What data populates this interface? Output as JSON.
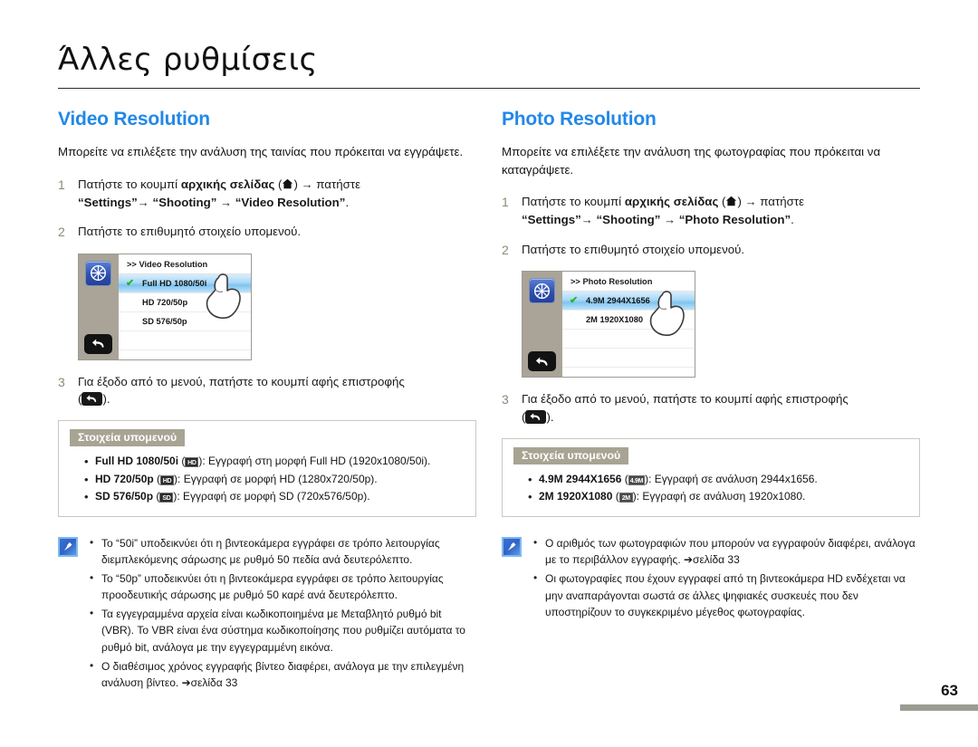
{
  "header": {
    "title": "Άλλες ρυθμίσεις"
  },
  "page_number": "63",
  "left": {
    "section_title": "Video Resolution",
    "intro": "Μπορείτε να επιλέξετε την ανάλυση της ταινίας που πρόκειται να εγγράψετε.",
    "steps": [
      {
        "num": "1",
        "lead": "Πατήστε το κουμπί ",
        "bold1": "αρχικής σελίδας",
        "paren_open": " (",
        "icon": "home-icon",
        "paren_close": ") ",
        "arrow1": "→",
        "mid": " πατήστε ",
        "q1": "“Settings”",
        "arrow2": "→",
        "q2": "“Shooting”",
        "arrow3": "→",
        "q3": "“Video Resolution”",
        "end": "."
      },
      {
        "num": "2",
        "text": "Πατήστε το επιθυμητό στοιχείο υπομενού."
      },
      {
        "num": "3",
        "text": "Για έξοδο από το μενού, πατήστε το κουμπί αφής επιστροφής",
        "tail_open": "(",
        "tail_icon": "return-icon",
        "tail_close": ")."
      }
    ],
    "lcd": {
      "header": ">> Video Resolution",
      "side_icon": "settings-wheel-icon",
      "back_icon": "return-arrow-icon",
      "rows": [
        {
          "label": "Full HD  1080/50i",
          "selected": true,
          "check": "✔"
        },
        {
          "label": "HD  720/50p",
          "selected": false
        },
        {
          "label": "SD  576/50p",
          "selected": false
        },
        {
          "label": "",
          "selected": false
        }
      ]
    },
    "subbox": {
      "badge": "Στοιχεία υπομενού",
      "items": [
        {
          "bold": "Full HD  1080/50i",
          "icon": "fullhd-badge",
          "icon_text": "HD",
          "rest": "): Εγγραφή στη μορφή Full HD (1920x1080/50i)."
        },
        {
          "bold": "HD  720/50p",
          "icon": "hd-badge",
          "icon_text": "HD",
          "rest": "): Εγγραφή σε μορφή HD (1280x720/50p)."
        },
        {
          "bold": "SD  576/50p",
          "icon": "sd-badge",
          "icon_text": "SD",
          "rest": "): Εγγραφή σε μορφή SD (720x576/50p)."
        }
      ]
    },
    "note": {
      "icon": "note-pen-icon",
      "items": [
        "Το “50i” υποδεικνύει ότι η βιντεοκάμερα εγγράφει σε τρόπο λειτουργίας διεμπλεκόμενης σάρωσης με ρυθμό 50 πεδία ανά δευτερόλεπτο.",
        "Το “50p” υποδεικνύει ότι η βιντεοκάμερα εγγράφει σε τρόπο λειτουργίας προοδευτικής σάρωσης με ρυθμό 50 καρέ ανά δευτερόλεπτο.",
        "Τα εγγεγραμμένα αρχεία είναι κωδικοποιημένα με Μεταβλητό ρυθμό bit (VBR). Το VBR είναι ένα σύστημα κωδικοποίησης που ρυθμίζει αυτόματα το ρυθμό bit, ανάλογα με την εγγεγραμμένη εικόνα.",
        "Ο διαθέσιμος χρόνος εγγραφής βίντεο διαφέρει, ανάλογα με την επιλεγμένη ανάλυση βίντεο.  ➔σελίδα 33"
      ]
    }
  },
  "right": {
    "section_title": "Photo Resolution",
    "intro": "Μπορείτε να επιλέξετε την ανάλυση της φωτογραφίας που πρόκειται να καταγράψετε.",
    "steps": [
      {
        "num": "1",
        "lead": "Πατήστε το κουμπί ",
        "bold1": "αρχικής σελίδας",
        "paren_open": " (",
        "icon": "home-icon",
        "paren_close": ") ",
        "arrow1": "→",
        "mid": " πατήστε ",
        "q1": "“Settings”",
        "arrow2": "→",
        "q2": "“Shooting”",
        "arrow3": "→",
        "q3": "“Photo Resolution”",
        "end": "."
      },
      {
        "num": "2",
        "text": "Πατήστε το επιθυμητό στοιχείο υπομενού."
      },
      {
        "num": "3",
        "text": "Για έξοδο από το μενού, πατήστε το κουμπί αφής επιστροφής",
        "tail_open": "(",
        "tail_icon": "return-icon",
        "tail_close": ")."
      }
    ],
    "lcd": {
      "header": ">> Photo Resolution",
      "side_icon": "settings-wheel-icon",
      "back_icon": "return-arrow-icon",
      "rows": [
        {
          "label": "4.9M  2944X1656",
          "selected": true,
          "check": "✔"
        },
        {
          "label": "2M   1920X1080",
          "selected": false
        },
        {
          "label": "",
          "selected": false
        },
        {
          "label": "",
          "selected": false
        }
      ]
    },
    "subbox": {
      "badge": "Στοιχεία υπομενού",
      "items": [
        {
          "bold": "4.9M  2944X1656",
          "icon": "res-49m-badge",
          "icon_text": "4.9M",
          "rest": "): Εγγραφή σε ανάλυση 2944x1656."
        },
        {
          "bold": "2M  1920X1080",
          "icon": "res-2m-badge",
          "icon_text": "2M",
          "rest": "): Εγγραφή σε ανάλυση 1920x1080."
        }
      ]
    },
    "note": {
      "icon": "note-pen-icon",
      "items": [
        "Ο αριθμός των φωτογραφιών που μπορούν να εγγραφούν διαφέρει, ανάλογα με το περιβάλλον εγγραφής. ➔σελίδα 33",
        "Οι φωτογραφίες που έχουν εγγραφεί από τη βιντεοκάμερα HD ενδέχεται να μην αναπαράγονται σωστά σε άλλες ψηφιακές συσκευές που δεν υποστηρίζουν το συγκεκριμένο μέγεθος φωτογραφίας."
      ]
    }
  },
  "colors": {
    "accent": "#2288e8",
    "badge": "#a8a493",
    "lcd_side": "#a9a497",
    "check": "#28b32a"
  }
}
